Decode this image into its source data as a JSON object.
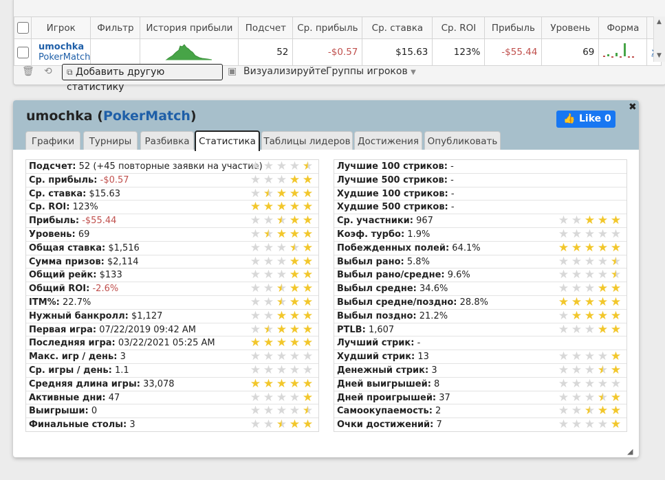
{
  "top_table": {
    "headers": [
      "Игрок",
      "Фильтр",
      "История прибыли",
      "Подсчет",
      "Ср. прибыль",
      "Ср. ставка",
      "Ср. ROI",
      "Прибыль",
      "Уровень",
      "Форма"
    ],
    "row": {
      "player_name": "umochka",
      "player_site": "PokerMatch",
      "count": "52",
      "avg_profit": "-$0.57",
      "avg_stake": "$15.63",
      "avg_roi": "123%",
      "profit": "-$55.44",
      "level": "69",
      "remove_link": "x"
    },
    "toolbar": {
      "add_stat": "Добавить другую статистику",
      "visualize": "Визуализируйте",
      "player_groups": "Группы игроков"
    }
  },
  "dialog": {
    "title_name": "umochka",
    "title_site": "PokerMatch",
    "title_open": "(",
    "title_close": ")",
    "like_label": "Like 0",
    "tabs": [
      "Графики",
      "Турниры",
      "Разбивка",
      "Статистика",
      "Таблицы лидеров",
      "Достижения",
      "Опубликовать"
    ],
    "active_tab": "Статистика",
    "left_stats": [
      {
        "label": "Подсчет:",
        "value": "52 (+45 повторные заявки на участие)",
        "stars": 0.5,
        "neg": false
      },
      {
        "label": "Ср. прибыль:",
        "value": "-$0.57",
        "stars": 2,
        "neg": true
      },
      {
        "label": "Ср. ставка:",
        "value": "$15.63",
        "stars": 3.5,
        "neg": false
      },
      {
        "label": "Ср. ROI:",
        "value": "123%",
        "stars": 5,
        "neg": false
      },
      {
        "label": "Прибыль:",
        "value": "-$55.44",
        "stars": 2.5,
        "neg": true
      },
      {
        "label": "Уровень:",
        "value": "69",
        "stars": 3.5,
        "neg": false
      },
      {
        "label": "Общая ставка:",
        "value": "$1,516",
        "stars": 1.5,
        "neg": false
      },
      {
        "label": "Сумма призов:",
        "value": "$2,114",
        "stars": 2,
        "neg": false
      },
      {
        "label": "Общий рейк:",
        "value": "$133",
        "stars": 2,
        "neg": false
      },
      {
        "label": "Общий ROI:",
        "value": "-2.6%",
        "stars": 2.5,
        "neg": true
      },
      {
        "label": "ITM%:",
        "value": "22.7%",
        "stars": 2.5,
        "neg": false
      },
      {
        "label": "Нужный банкролл:",
        "value": "$1,127",
        "stars": 3,
        "neg": false
      },
      {
        "label": "Первая игра:",
        "value": "07/22/2019 09:42 AM",
        "stars": 3.5,
        "neg": false
      },
      {
        "label": "Последняя игра:",
        "value": "03/22/2021 05:25 AM",
        "stars": 5,
        "neg": false
      },
      {
        "label": "Макс. игр / день:",
        "value": "3",
        "stars": 0,
        "neg": false
      },
      {
        "label": "Ср. игры / день:",
        "value": "1.1",
        "stars": 0,
        "neg": false
      },
      {
        "label": "Средняя длина игры:",
        "value": "33,078",
        "stars": 5,
        "neg": false
      },
      {
        "label": "Активные дни:",
        "value": "47",
        "stars": 1,
        "neg": false
      },
      {
        "label": "Выигрыши:",
        "value": "0",
        "stars": 0.5,
        "neg": false
      },
      {
        "label": "Финальные столы:",
        "value": "3",
        "stars": 2.5,
        "neg": false
      }
    ],
    "right_stats": [
      {
        "label": "Лучшие 100 стриков:",
        "value": "-",
        "stars": null,
        "neg": false
      },
      {
        "label": "Лучшие 500 стриков:",
        "value": "-",
        "stars": null,
        "neg": false
      },
      {
        "label": "Худшие 100 стриков:",
        "value": "-",
        "stars": null,
        "neg": false
      },
      {
        "label": "Худшие 500 стриков:",
        "value": "-",
        "stars": null,
        "neg": false
      },
      {
        "label": "Ср. участники:",
        "value": "967",
        "stars": 3,
        "neg": false
      },
      {
        "label": "Коэф. турбо:",
        "value": "1.9%",
        "stars": 0,
        "neg": false
      },
      {
        "label": "Побежденных полей:",
        "value": "64.1%",
        "stars": 5,
        "neg": false
      },
      {
        "label": "Выбыл рано:",
        "value": "5.8%",
        "stars": 0.5,
        "neg": false
      },
      {
        "label": "Выбыл рано/средне:",
        "value": "9.6%",
        "stars": 0.5,
        "neg": false
      },
      {
        "label": "Выбыл средне:",
        "value": "34.6%",
        "stars": 2,
        "neg": false
      },
      {
        "label": "Выбыл средне/поздно:",
        "value": "28.8%",
        "stars": 5,
        "neg": false
      },
      {
        "label": "Выбыл поздно:",
        "value": "21.2%",
        "stars": 4,
        "neg": false
      },
      {
        "label": "PTLB:",
        "value": "1,607",
        "stars": 2,
        "neg": false
      },
      {
        "label": "Лучший стрик:",
        "value": "-",
        "stars": null,
        "neg": false
      },
      {
        "label": "Худший стрик:",
        "value": "13",
        "stars": 1,
        "neg": false
      },
      {
        "label": "Денежный стрик:",
        "value": "3",
        "stars": 1.5,
        "neg": false
      },
      {
        "label": "Дней выигрышей:",
        "value": "8",
        "stars": 0,
        "neg": false
      },
      {
        "label": "Дней проигрышей:",
        "value": "37",
        "stars": 1.5,
        "neg": false
      },
      {
        "label": "Самоокупаемость:",
        "value": "2",
        "stars": 2.5,
        "neg": false
      },
      {
        "label": "Очки достижений:",
        "value": "7",
        "stars": 1,
        "neg": false
      }
    ]
  },
  "colors": {
    "negative": "#c0504d",
    "link": "#1f5fa8",
    "header_bg": "#a7bfcb",
    "like_bg": "#1877f2",
    "star": "#f2c72c"
  }
}
